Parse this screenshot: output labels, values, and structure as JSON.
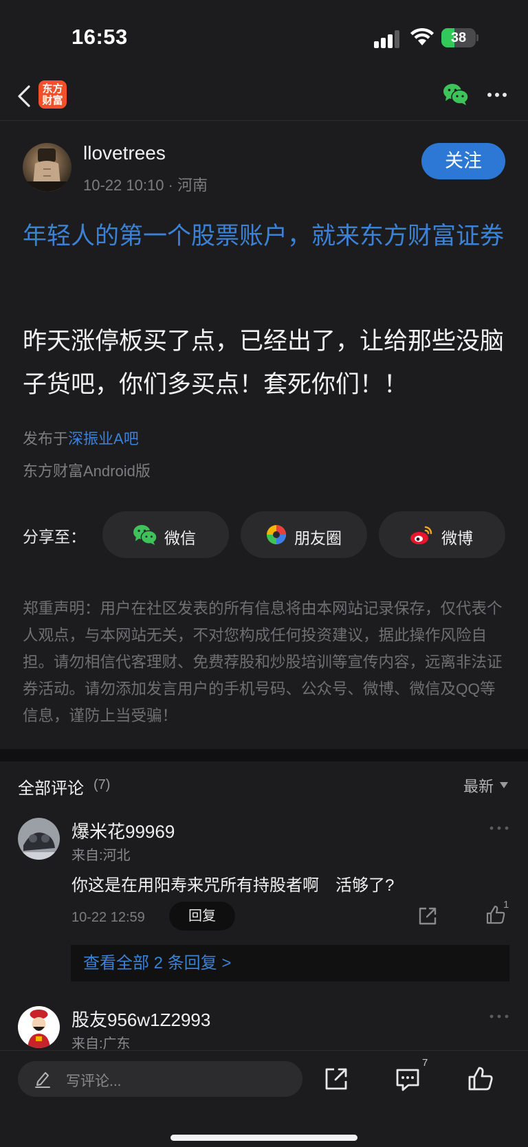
{
  "status_bar": {
    "time": "16:53",
    "battery": "38",
    "battery_level": 0.38
  },
  "nav": {
    "logo_text": "东方财富",
    "icons": [
      "back-icon",
      "wechat-icon",
      "more-icon"
    ]
  },
  "post": {
    "author": "llovetrees",
    "meta": "10-22 10:10 · 河南",
    "follow_label": "关注",
    "ad_title": "年轻人的第一个股票账户，就来东方财富证券",
    "content": "昨天涨停板买了点，已经出了，让给那些没脑子货吧，你们多买点！套死你们！！",
    "published_prefix": "发布于",
    "forum": "深振业A吧",
    "client": "东方财富Android版"
  },
  "share": {
    "label": "分享至：",
    "buttons": [
      {
        "label": "微信",
        "icon": "wechat-icon"
      },
      {
        "label": "朋友圈",
        "icon": "moments-icon"
      },
      {
        "label": "微博",
        "icon": "weibo-icon"
      }
    ]
  },
  "disclaimer": "郑重声明：用户在社区发表的所有信息将由本网站记录保存，仅代表个人观点，与本网站无关，不对您构成任何投资建议，据此操作风险自担。请勿相信代客理财、免费荐股和炒股培训等宣传内容，远离非法证券活动。请勿添加发言用户的手机号码、公众号、微博、微信及QQ等信息，谨防上当受骗！",
  "comments": {
    "title": "全部评论",
    "count": "(7)",
    "sort": "最新",
    "items": [
      {
        "name": "爆米花99969",
        "from": "来自:河北",
        "text": "你这是在用阳寿来咒所有持股者啊　活够了?",
        "time": "10-22 12:59",
        "reply_label": "回复",
        "likes": "1",
        "view_replies": "查看全部 2 条回复 >"
      },
      {
        "name": "股友956w1Z2993",
        "from": "来自:广东"
      }
    ]
  },
  "bottom_bar": {
    "placeholder": "写评论...",
    "comment_count": "7",
    "icons": [
      "share-icon",
      "comment-icon",
      "like-icon"
    ]
  },
  "colors": {
    "accent": "#2d78d4",
    "link": "#3b82d6",
    "background": "#1c1c1e",
    "logo": "#f0502a"
  }
}
